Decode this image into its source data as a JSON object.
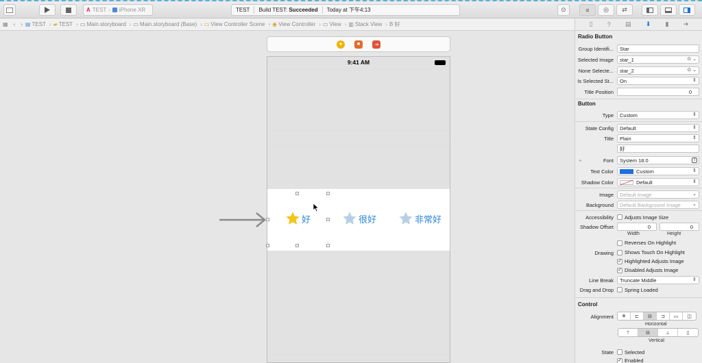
{
  "toolbar": {
    "scheme_project": "TEST",
    "scheme_device": "iPhone XR",
    "status_project": "TEST",
    "status_build_prefix": "Build TEST:",
    "status_build_result": "Succeeded",
    "status_time": "Today at 下午4:13"
  },
  "jumpbar": {
    "crumbs": [
      "TEST",
      "TEST",
      "Main.storyboard",
      "Main.storyboard (Base)",
      "View Controller Scene",
      "View Controller",
      "View",
      "Stack View",
      "B 好"
    ]
  },
  "canvas": {
    "time": "9:41 AM",
    "buttons": [
      {
        "label": "好",
        "star_color": "#f5c518"
      },
      {
        "label": "很好",
        "star_color": "#b7cfe6"
      },
      {
        "label": "非常好",
        "star_color": "#b7cfe6"
      }
    ]
  },
  "inspector": {
    "radio_section": "Radio Button",
    "group_identifier_label": "Group Identifi...",
    "group_identifier_value": "Star",
    "selected_image_label": "Selected Image",
    "selected_image_value": "star_1",
    "none_selected_label": "None Selecte...",
    "none_selected_value": "star_2",
    "is_selected_label": "Is Selected St...",
    "is_selected_value": "On",
    "title_position_label": "Title Position",
    "title_position_value": "0",
    "button_section": "Button",
    "type_label": "Type",
    "type_value": "Custom",
    "state_config_label": "State Config",
    "state_config_value": "Default",
    "title_label": "Title",
    "title_value": "Plain",
    "title_text": "好",
    "font_label": "Font",
    "font_value": "System 18.0",
    "text_color_label": "Text Color",
    "text_color_value": "Custom",
    "text_color_hex": "#1d6fde",
    "shadow_color_label": "Shadow Color",
    "shadow_color_value": "Default",
    "image_label": "Image",
    "image_placeholder": "Default Image",
    "background_label": "Background",
    "background_placeholder": "Default Background Image",
    "accessibility_label": "Accessibility",
    "adjusts_image_size": "Adjusts Image Size",
    "shadow_offset_label": "Shadow Offset",
    "shadow_width": "0",
    "shadow_height": "0",
    "width_caption": "Width",
    "height_caption": "Height",
    "drawing_label": "Drawing",
    "reverses": "Reverses On Highlight",
    "shows_touch": "Shows Touch On Highlight",
    "highlighted_adjusts": "Highlighted Adjusts Image",
    "disabled_adjusts": "Disabled Adjusts Image",
    "line_break_label": "Line Break",
    "line_break_value": "Truncate Middle",
    "drag_drop_label": "Drag and Drop",
    "spring_loaded": "Spring Loaded",
    "control_section": "Control",
    "alignment_label": "Alignment",
    "horizontal_caption": "Horizontal",
    "vertical_caption": "Vertical",
    "state_label": "State",
    "selected_text": "Selected",
    "enabled_text": "Enabled"
  }
}
